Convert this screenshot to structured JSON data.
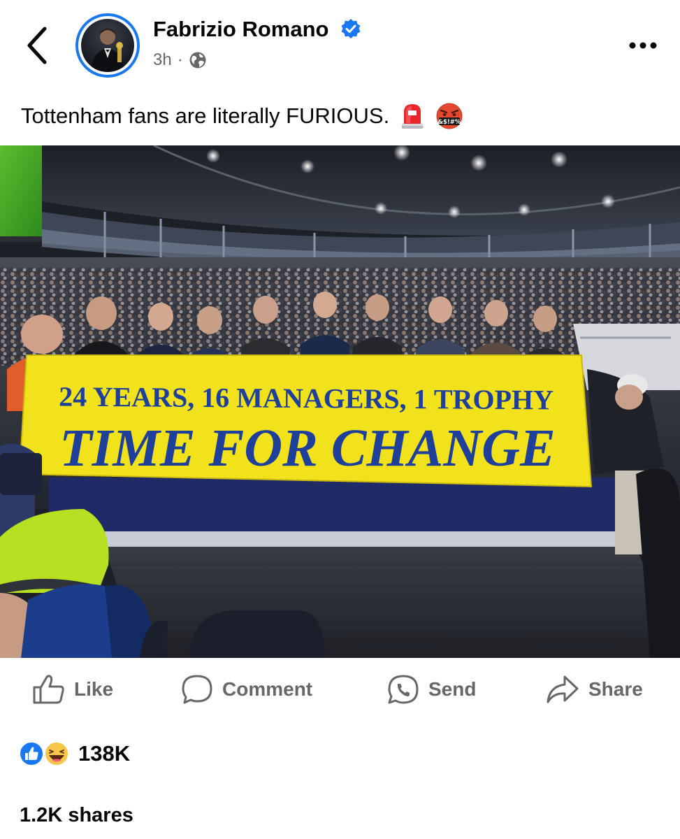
{
  "post": {
    "author": "Fabrizio Romano",
    "time": "3h",
    "separator": "·",
    "caption": "Tottenham fans are literally FURIOUS.",
    "caption_emojis": [
      "rotating-light-emoji",
      "symbols-on-mouth-emoji"
    ]
  },
  "photo": {
    "banner_line1": "24 YEARS, 16 MANAGERS, 1 TROPHY",
    "banner_line2": "TIME FOR CHANGE"
  },
  "actions": {
    "like": "Like",
    "comment": "Comment",
    "send": "Send",
    "share": "Share"
  },
  "stats": {
    "reactions_count": "138K",
    "shares": "1.2K shares"
  },
  "colors": {
    "brand_blue": "#1877f2",
    "action_gray": "#65676b",
    "banner_yellow": "#f2e21c",
    "banner_text": "#1e3f9a"
  }
}
